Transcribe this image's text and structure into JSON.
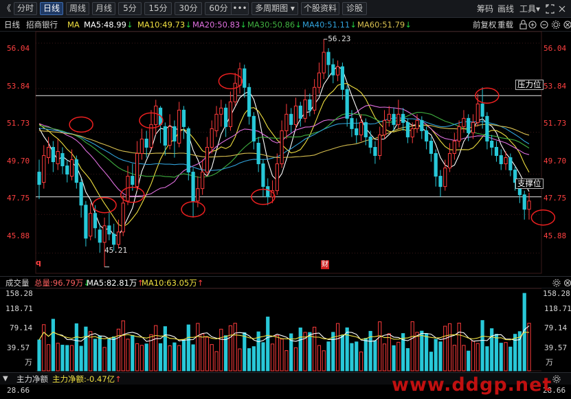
{
  "toolbar": {
    "back": "《",
    "tabs": [
      "分时",
      "日线",
      "周线",
      "月线",
      "5分",
      "15分",
      "30分",
      "60分"
    ],
    "active": "日线",
    "more": "•••",
    "multi": "多周期图",
    "dropdown_arrow": "▾",
    "info": "个股资料",
    "diag": "诊股",
    "right": [
      "筹码",
      "画线",
      "工具"
    ],
    "tools_arrow": "▾"
  },
  "ma_bar": {
    "period": "日线",
    "stock": "招商银行",
    "ma_label": "MA",
    "items": [
      {
        "text": "MA5:48.99",
        "arrow": "↓",
        "color": "#ffffff"
      },
      {
        "text": "MA10:49.73",
        "arrow": "↓",
        "color": "#f0e040"
      },
      {
        "text": "MA20:50.83",
        "arrow": "↓",
        "color": "#e070e0"
      },
      {
        "text": "MA30:50.86",
        "arrow": "↓",
        "color": "#40b040"
      },
      {
        "text": "MA40:51.11",
        "arrow": "↓",
        "color": "#30a0d8"
      },
      {
        "text": "MA60:51.79",
        "arrow": "↓",
        "color": "#d8c050"
      }
    ],
    "right": [
      "前复权",
      "重载"
    ]
  },
  "price_axis": [
    "56.04",
    "53.84",
    "51.73",
    "49.70",
    "47.75",
    "45.88"
  ],
  "annotations": {
    "high": "56.23",
    "low": "45.21",
    "resistance": "压力位",
    "support": "支撑位",
    "marker_q": "q",
    "marker_cai": "财"
  },
  "volume_bar": {
    "title": "成交量",
    "total": "总量:96.79万",
    "total_arrow": "↓",
    "ma5": "MA5:82.81万",
    "ma5_arrow": "↑",
    "ma10": "MA10:63.05万",
    "ma10_arrow": "↑"
  },
  "volume_axis": [
    "158.28",
    "118.71",
    "79.14",
    "39.57",
    "万"
  ],
  "flow_bar": {
    "title": "主力净额",
    "value": "主力净额:-0.47亿",
    "arrow": "↑",
    "axis": "28.66"
  },
  "watermark": "www.ddgp.net",
  "colors": {
    "up": "#ff3c3c",
    "down": "#28c8d8",
    "bg": "#000000"
  },
  "chart_data": {
    "type": "candlestick",
    "ylim": [
      44.9,
      56.6
    ],
    "series": [
      {
        "name": "MA5",
        "color": "#ffffff",
        "values": [
          48.99
        ]
      },
      {
        "name": "MA10",
        "color": "#f0e040",
        "values": [
          49.73
        ]
      },
      {
        "name": "MA20",
        "color": "#e070e0",
        "values": [
          50.83
        ]
      },
      {
        "name": "MA30",
        "color": "#40b040",
        "values": [
          50.86
        ]
      },
      {
        "name": "MA40",
        "color": "#30a0d8",
        "values": [
          51.11
        ]
      },
      {
        "name": "MA60",
        "color": "#d8c050",
        "values": [
          51.79
        ]
      }
    ],
    "high": 56.23,
    "low": 45.21,
    "resistance": 53.5,
    "support": 48.6,
    "candles": [
      [
        49.8,
        49.2,
        50.4,
        48.5
      ],
      [
        49.3,
        50.6,
        51.1,
        49.0
      ],
      [
        50.5,
        51.0,
        51.5,
        50.2
      ],
      [
        51.0,
        50.3,
        51.3,
        49.8
      ],
      [
        50.2,
        50.8,
        51.4,
        49.9
      ],
      [
        50.7,
        50.1,
        51.0,
        49.7
      ],
      [
        50.1,
        49.7,
        50.4,
        49.3
      ],
      [
        49.6,
        50.4,
        50.9,
        49.4
      ],
      [
        50.4,
        49.3,
        50.6,
        49.0
      ],
      [
        49.3,
        48.2,
        49.5,
        47.6
      ],
      [
        48.2,
        46.6,
        48.4,
        46.2
      ],
      [
        46.7,
        47.8,
        48.3,
        46.5
      ],
      [
        47.8,
        47.1,
        48.2,
        46.6
      ],
      [
        47.0,
        46.4,
        47.3,
        45.9
      ],
      [
        46.4,
        47.2,
        47.6,
        45.21
      ],
      [
        47.2,
        46.8,
        47.9,
        46.5
      ],
      [
        46.8,
        46.3,
        47.3,
        46.0
      ],
      [
        46.3,
        46.9,
        47.5,
        46.1
      ],
      [
        46.9,
        48.3,
        48.7,
        46.7
      ],
      [
        48.4,
        49.6,
        50.1,
        48.2
      ],
      [
        49.6,
        49.2,
        50.2,
        48.9
      ],
      [
        49.1,
        50.7,
        51.3,
        48.9
      ],
      [
        50.7,
        51.4,
        51.9,
        50.4
      ],
      [
        51.4,
        51.0,
        51.8,
        50.5
      ],
      [
        51.0,
        52.1,
        52.8,
        50.9
      ],
      [
        52.1,
        53.0,
        53.3,
        51.6
      ],
      [
        52.9,
        52.1,
        53.0,
        51.2
      ],
      [
        52.0,
        51.1,
        52.2,
        50.6
      ],
      [
        51.1,
        52.0,
        52.6,
        50.9
      ],
      [
        52.0,
        51.3,
        52.3,
        50.5
      ],
      [
        51.2,
        52.8,
        53.2,
        51.0
      ],
      [
        52.8,
        52.0,
        53.0,
        51.4
      ],
      [
        51.9,
        49.8,
        52.0,
        49.4
      ],
      [
        49.8,
        48.4,
        50.0,
        47.6
      ],
      [
        48.4,
        49.0,
        49.6,
        48.1
      ],
      [
        49.0,
        49.8,
        50.4,
        48.7
      ],
      [
        49.8,
        51.0,
        51.5,
        49.6
      ],
      [
        51.0,
        51.9,
        52.3,
        50.7
      ],
      [
        51.8,
        52.6,
        53.0,
        51.5
      ],
      [
        52.6,
        52.9,
        53.3,
        52.0
      ],
      [
        52.9,
        52.0,
        53.1,
        51.5
      ],
      [
        52.0,
        53.2,
        53.7,
        51.8
      ],
      [
        53.2,
        54.1,
        54.6,
        53.0
      ],
      [
        54.0,
        54.8,
        55.1,
        53.6
      ],
      [
        54.8,
        53.9,
        55.0,
        53.4
      ],
      [
        53.9,
        52.5,
        54.1,
        52.1
      ],
      [
        52.5,
        51.3,
        52.7,
        50.9
      ],
      [
        51.2,
        50.2,
        51.5,
        49.8
      ],
      [
        50.2,
        49.1,
        50.4,
        48.6
      ],
      [
        49.1,
        48.6,
        49.5,
        48.2
      ],
      [
        48.6,
        48.9,
        49.4,
        48.3
      ],
      [
        48.9,
        50.2,
        50.7,
        48.7
      ],
      [
        50.2,
        51.8,
        52.3,
        50.0
      ],
      [
        51.8,
        52.6,
        53.1,
        51.4
      ],
      [
        52.6,
        52.1,
        52.9,
        51.7
      ],
      [
        52.1,
        53.0,
        53.4,
        51.9
      ],
      [
        53.0,
        52.4,
        53.2,
        52.0
      ],
      [
        52.4,
        53.3,
        53.8,
        52.2
      ],
      [
        53.3,
        52.8,
        53.6,
        52.5
      ],
      [
        52.8,
        53.9,
        54.3,
        52.6
      ],
      [
        53.9,
        54.6,
        55.1,
        53.6
      ],
      [
        54.6,
        55.6,
        56.23,
        54.3
      ],
      [
        55.6,
        55.0,
        55.8,
        54.4
      ],
      [
        55.0,
        54.5,
        55.3,
        54.1
      ],
      [
        54.5,
        54.9,
        55.2,
        54.2
      ],
      [
        54.9,
        53.8,
        55.1,
        53.3
      ],
      [
        53.8,
        52.4,
        54.0,
        52.0
      ],
      [
        52.4,
        51.9,
        52.8,
        51.5
      ],
      [
        51.9,
        51.6,
        52.4,
        51.2
      ],
      [
        51.6,
        52.2,
        52.6,
        51.3
      ],
      [
        52.2,
        51.5,
        52.4,
        51.1
      ],
      [
        51.5,
        51.0,
        51.8,
        50.7
      ],
      [
        51.0,
        50.6,
        51.3,
        50.2
      ],
      [
        50.6,
        51.6,
        52.0,
        50.4
      ],
      [
        51.6,
        52.3,
        52.8,
        51.4
      ],
      [
        52.3,
        52.6,
        53.0,
        52.0
      ],
      [
        52.6,
        52.1,
        52.9,
        51.8
      ],
      [
        52.1,
        52.6,
        53.3,
        51.9
      ],
      [
        52.6,
        52.2,
        52.9,
        51.8
      ],
      [
        52.2,
        51.5,
        52.4,
        51.2
      ],
      [
        51.5,
        51.9,
        52.2,
        51.2
      ],
      [
        51.9,
        52.3,
        52.6,
        51.7
      ],
      [
        52.3,
        51.8,
        52.5,
        51.4
      ],
      [
        51.8,
        51.3,
        52.0,
        50.9
      ],
      [
        51.3,
        50.7,
        51.5,
        50.3
      ],
      [
        50.7,
        49.6,
        50.9,
        49.1
      ],
      [
        49.6,
        49.1,
        49.9,
        48.6
      ],
      [
        49.1,
        50.0,
        50.4,
        48.9
      ],
      [
        50.0,
        50.7,
        51.2,
        49.8
      ],
      [
        50.7,
        51.3,
        51.7,
        50.4
      ],
      [
        51.3,
        52.0,
        52.3,
        51.0
      ],
      [
        52.0,
        52.4,
        52.8,
        51.7
      ],
      [
        52.4,
        51.7,
        52.6,
        51.3
      ],
      [
        51.7,
        52.2,
        52.6,
        51.4
      ],
      [
        52.2,
        53.1,
        53.6,
        52.0
      ],
      [
        53.1,
        52.5,
        53.9,
        51.9
      ],
      [
        52.5,
        51.3,
        52.7,
        50.9
      ],
      [
        51.3,
        51.0,
        51.6,
        50.6
      ],
      [
        51.0,
        50.6,
        51.3,
        50.3
      ],
      [
        50.6,
        50.2,
        50.9,
        49.9
      ],
      [
        50.2,
        50.5,
        50.8,
        49.9
      ],
      [
        50.5,
        49.9,
        50.7,
        49.6
      ],
      [
        49.9,
        49.3,
        50.1,
        48.9
      ],
      [
        49.3,
        48.7,
        49.5,
        48.3
      ],
      [
        48.7,
        48.0,
        48.9,
        47.5
      ],
      [
        48.0,
        48.4,
        48.8,
        47.5
      ]
    ]
  }
}
